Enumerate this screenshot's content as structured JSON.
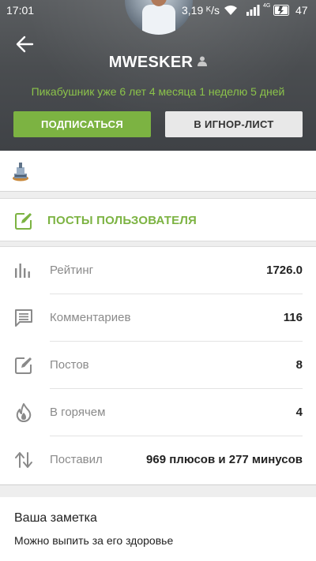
{
  "status_bar": {
    "time": "17:01",
    "network_speed": "3,19 ᴷ/s",
    "network_type": "4G",
    "battery": "47"
  },
  "profile": {
    "username": "MWESKER",
    "tenure": "Пикабушник уже 6 лет 4 месяца 1 неделю 5 дней",
    "subscribe_label": "ПОДПИСАТЬСЯ",
    "ignore_label": "В ИГНОР-ЛИСТ"
  },
  "posts_link": {
    "label": "ПОСТЫ ПОЛЬЗОВАТЕЛЯ"
  },
  "stats": [
    {
      "icon": "bar-chart-icon",
      "label": "Рейтинг",
      "value": "1726.0"
    },
    {
      "icon": "comment-icon",
      "label": "Комментариев",
      "value": "116"
    },
    {
      "icon": "edit-icon",
      "label": "Постов",
      "value": "8"
    },
    {
      "icon": "flame-icon",
      "label": "В горячем",
      "value": "4"
    },
    {
      "icon": "sort-arrows-icon",
      "label": "Поставил",
      "value": "969 плюсов и 277 минусов"
    }
  ],
  "note": {
    "title": "Ваша заметка",
    "text": "Можно выпить за его здоровье"
  },
  "colors": {
    "accent_green": "#7cb342",
    "tenure_green": "#8bc34a",
    "header_bg": "#4a4d50"
  }
}
